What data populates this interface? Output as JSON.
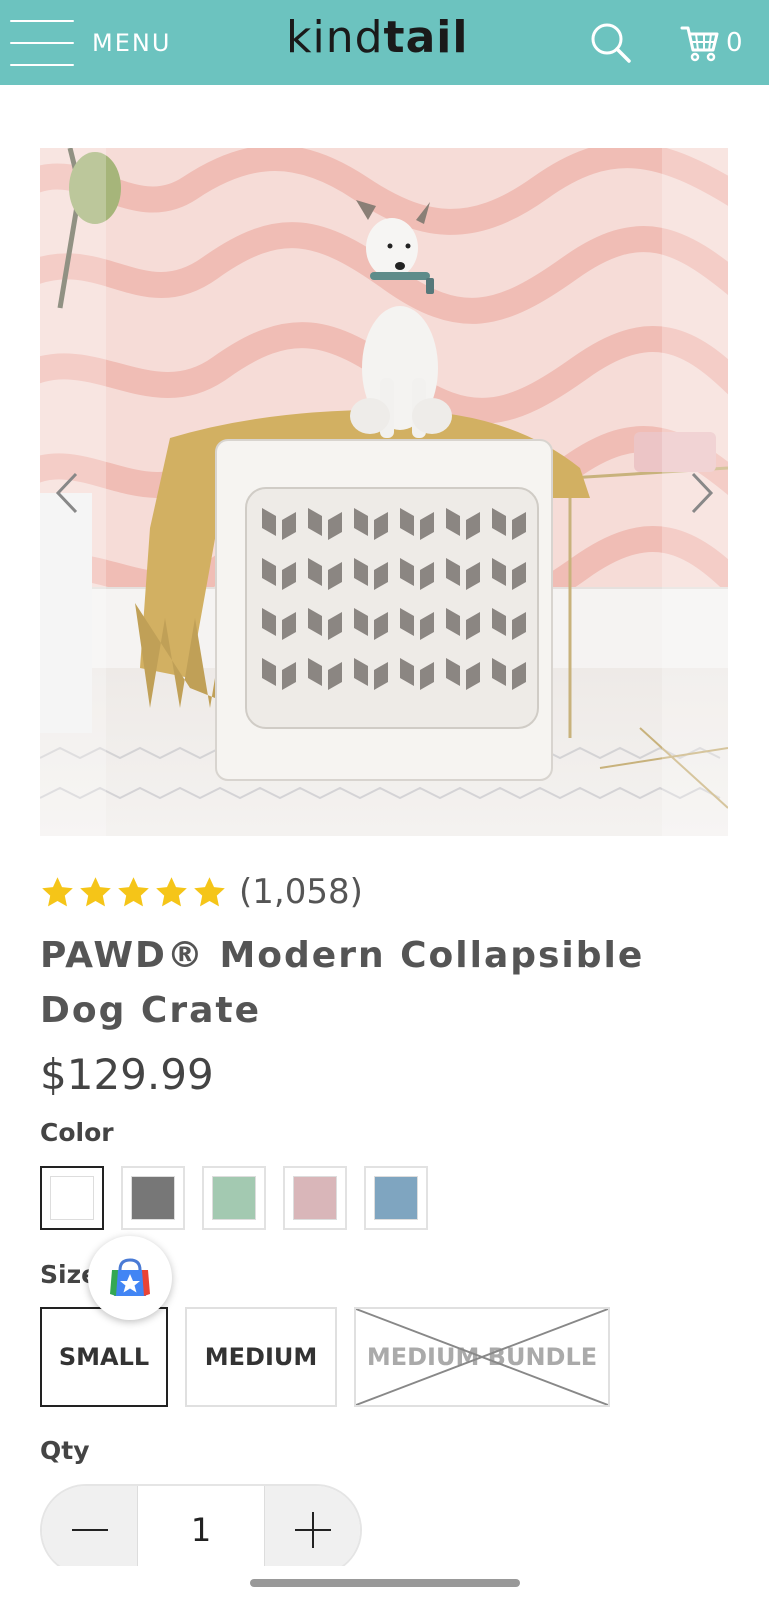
{
  "header": {
    "menu_label": "MENU",
    "logo_light": "kind",
    "logo_bold": "tail",
    "cart_count": "0",
    "background": "#6cc3bf"
  },
  "gallery": {
    "alt": "White dog sitting on top of a white collapsible dog crate draped with a mustard blanket"
  },
  "product": {
    "rating_stars": 5,
    "rating_count": "(1,058)",
    "title": "PAWD® Modern Collapsible Dog Crate",
    "price": "$129.99"
  },
  "color": {
    "label": "Color",
    "options": [
      {
        "name": "white",
        "hex": "#ffffff",
        "selected": true
      },
      {
        "name": "gray",
        "hex": "#777777",
        "selected": false
      },
      {
        "name": "sage",
        "hex": "#a3c9b1",
        "selected": false
      },
      {
        "name": "blush",
        "hex": "#d9b6b9",
        "selected": false
      },
      {
        "name": "blue",
        "hex": "#7fa5c0",
        "selected": false
      }
    ]
  },
  "size": {
    "label": "Size",
    "options": [
      {
        "label": "SMALL",
        "selected": true,
        "disabled": false
      },
      {
        "label": "MEDIUM",
        "selected": false,
        "disabled": false
      },
      {
        "label": "MEDIUM BUNDLE",
        "selected": false,
        "disabled": true
      }
    ]
  },
  "qty": {
    "label": "Qty",
    "value": "1"
  },
  "colors": {
    "star": "#f5c518",
    "text": "#444444"
  }
}
